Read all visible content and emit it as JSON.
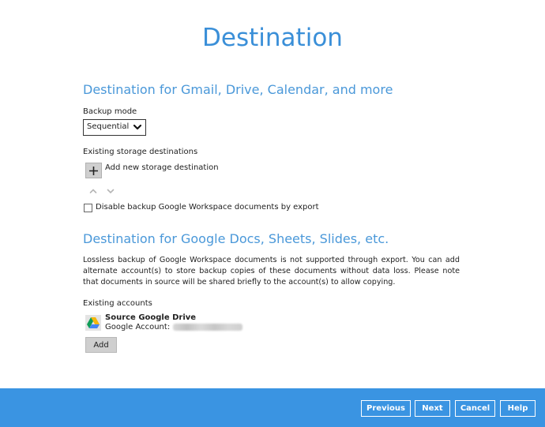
{
  "page": {
    "title": "Destination"
  },
  "gmail_section": {
    "title": "Destination for Gmail, Drive, Calendar, and more",
    "backup_mode_label": "Backup mode",
    "backup_mode_value": "Sequential",
    "storage_label": "Existing storage destinations",
    "add_storage_label": "Add new storage destination",
    "disable_export_label": "Disable backup Google Workspace documents by export",
    "disable_export_checked": false
  },
  "docs_section": {
    "title": "Destination for Google Docs, Sheets, Slides, etc.",
    "description": "Lossless backup of Google Workspace documents is not supported through export. You can add alternate account(s) to store backup copies of these documents without data loss. Please note that documents in source will be shared briefly to the account(s) to allow copying.",
    "accounts_label": "Existing accounts",
    "account": {
      "name": "Source Google Drive",
      "account_prefix": "Google Account:"
    },
    "add_label": "Add"
  },
  "footer": {
    "previous_label": "Previous",
    "next_label": "Next",
    "cancel_label": "Cancel",
    "help_label": "Help"
  },
  "colors": {
    "accent": "#3a8fd8",
    "footer_bg": "#3a94e2"
  },
  "icons": {
    "add": "plus-icon",
    "move_up": "chevron-up-icon",
    "move_down": "chevron-down-icon",
    "drive": "google-drive-icon",
    "dropdown": "chevron-down-icon"
  }
}
